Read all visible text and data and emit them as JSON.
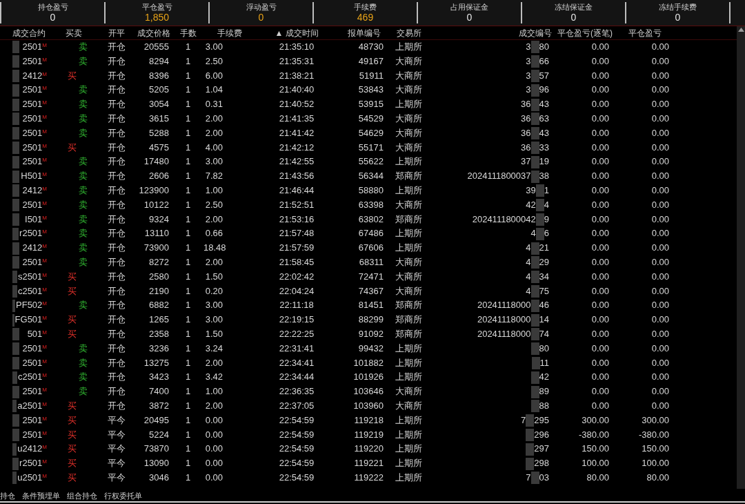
{
  "summary": [
    {
      "label": "持仓盈亏",
      "value": "0",
      "color": "#e6e6e6"
    },
    {
      "label": "平仓盈亏",
      "value": "1,850",
      "color": "#e8a317"
    },
    {
      "label": "浮动盈亏",
      "value": "0",
      "color": "#e8a317"
    },
    {
      "label": "手续费",
      "value": "469",
      "color": "#e8a317"
    },
    {
      "label": "占用保证金",
      "value": "0",
      "color": "#e6e6e6"
    },
    {
      "label": "冻结保证金",
      "value": "0",
      "color": "#e6e6e6"
    },
    {
      "label": "冻结手续费",
      "value": "0",
      "color": "#e6e6e6"
    }
  ],
  "table": {
    "columns": [
      "成交合约",
      "买卖",
      "开平",
      "成交价格",
      "手数",
      "手续费",
      "▲ 成交时间",
      "报单编号",
      "交易所",
      "成交编号",
      "平仓盈亏(逐笔)",
      "平仓盈亏"
    ],
    "rows": [
      {
        "contract": "2501$^{M}$",
        "kind": "sell",
        "side": "卖",
        "offset": "开仓",
        "price": "20555",
        "qty": "1",
        "fee": "3.00",
        "time": "21:35:10",
        "order_no": "48730",
        "exchange": "上期所",
        "trade_id_start": "3",
        "trade_id_end": "80",
        "pnl_trade": "0.00",
        "pnl": "0.00"
      },
      {
        "contract": "2501$^{M}$",
        "kind": "sell",
        "side": "卖",
        "offset": "开仓",
        "price": "8294",
        "qty": "1",
        "fee": "2.50",
        "time": "21:35:31",
        "order_no": "49167",
        "exchange": "大商所",
        "trade_id_start": "3",
        "trade_id_end": "66",
        "pnl_trade": "0.00",
        "pnl": "0.00"
      },
      {
        "contract": "2412$^{M}$",
        "kind": "buy",
        "side": "买",
        "offset": "开仓",
        "price": "8396",
        "qty": "1",
        "fee": "6.00",
        "time": "21:38:21",
        "order_no": "51911",
        "exchange": "大商所",
        "trade_id_start": "3",
        "trade_id_end": "57",
        "pnl_trade": "0.00",
        "pnl": "0.00"
      },
      {
        "contract": "2501$^{M}$",
        "kind": "sell",
        "side": "卖",
        "offset": "开仓",
        "price": "5205",
        "qty": "1",
        "fee": "1.04",
        "time": "21:40:40",
        "order_no": "53843",
        "exchange": "大商所",
        "trade_id_start": "3",
        "trade_id_end": "96",
        "pnl_trade": "0.00",
        "pnl": "0.00"
      },
      {
        "contract": "2501$^{M}$",
        "kind": "sell",
        "side": "卖",
        "offset": "开仓",
        "price": "3054",
        "qty": "1",
        "fee": "0.31",
        "time": "21:40:52",
        "order_no": "53915",
        "exchange": "上期所",
        "trade_id_start": "36",
        "trade_id_end": "43",
        "pnl_trade": "0.00",
        "pnl": "0.00"
      },
      {
        "contract": "2501$^{M}$",
        "kind": "sell",
        "side": "卖",
        "offset": "开仓",
        "price": "3615",
        "qty": "1",
        "fee": "2.00",
        "time": "21:41:35",
        "order_no": "54529",
        "exchange": "大商所",
        "trade_id_start": "36",
        "trade_id_end": "63",
        "pnl_trade": "0.00",
        "pnl": "0.00"
      },
      {
        "contract": "2501$^{M}$",
        "kind": "sell",
        "side": "卖",
        "offset": "开仓",
        "price": "5288",
        "qty": "1",
        "fee": "2.00",
        "time": "21:41:42",
        "order_no": "54629",
        "exchange": "大商所",
        "trade_id_start": "36",
        "trade_id_end": "43",
        "pnl_trade": "0.00",
        "pnl": "0.00"
      },
      {
        "contract": "2501$^{M}$",
        "kind": "buy",
        "side": "买",
        "offset": "开仓",
        "price": "4575",
        "qty": "1",
        "fee": "4.00",
        "time": "21:42:12",
        "order_no": "55171",
        "exchange": "大商所",
        "trade_id_start": "36",
        "trade_id_end": "33",
        "pnl_trade": "0.00",
        "pnl": "0.00"
      },
      {
        "contract": "2501$^{M}$",
        "kind": "sell",
        "side": "卖",
        "offset": "开仓",
        "price": "17480",
        "qty": "1",
        "fee": "3.00",
        "time": "21:42:55",
        "order_no": "55622",
        "exchange": "上期所",
        "trade_id_start": "37",
        "trade_id_end": "19",
        "pnl_trade": "0.00",
        "pnl": "0.00"
      },
      {
        "contract": "H501$^{M}$",
        "kind": "sell",
        "side": "卖",
        "offset": "开仓",
        "price": "2606",
        "qty": "1",
        "fee": "7.82",
        "time": "21:43:56",
        "order_no": "56344",
        "exchange": "郑商所",
        "trade_id_start": "2024111800037",
        "trade_id_end": "38",
        "pnl_trade": "0.00",
        "pnl": "0.00"
      },
      {
        "contract": "2412$^{M}$",
        "kind": "sell",
        "side": "卖",
        "offset": "开仓",
        "price": "123900",
        "qty": "1",
        "fee": "1.00",
        "time": "21:46:44",
        "order_no": "58880",
        "exchange": "上期所",
        "trade_id_start": "39",
        "trade_id_end": "1",
        "pnl_trade": "0.00",
        "pnl": "0.00"
      },
      {
        "contract": "2501$^{M}$",
        "kind": "sell",
        "side": "卖",
        "offset": "开仓",
        "price": "10122",
        "qty": "1",
        "fee": "2.50",
        "time": "21:52:51",
        "order_no": "63398",
        "exchange": "大商所",
        "trade_id_start": "42",
        "trade_id_end": "4",
        "pnl_trade": "0.00",
        "pnl": "0.00"
      },
      {
        "contract": "I501$^{M}$",
        "kind": "sell",
        "side": "卖",
        "offset": "开仓",
        "price": "9324",
        "qty": "1",
        "fee": "2.00",
        "time": "21:53:16",
        "order_no": "63802",
        "exchange": "郑商所",
        "trade_id_start": "2024111800042",
        "trade_id_end": "9",
        "pnl_trade": "0.00",
        "pnl": "0.00"
      },
      {
        "contract": "r2501$^{M}$",
        "kind": "sell",
        "side": "卖",
        "offset": "开仓",
        "price": "13110",
        "qty": "1",
        "fee": "0.66",
        "time": "21:57:48",
        "order_no": "67486",
        "exchange": "上期所",
        "trade_id_start": "4",
        "trade_id_end": "6",
        "pnl_trade": "0.00",
        "pnl": "0.00"
      },
      {
        "contract": "2412$^{M}$",
        "kind": "sell",
        "side": "卖",
        "offset": "开仓",
        "price": "73900",
        "qty": "1",
        "fee": "18.48",
        "time": "21:57:59",
        "order_no": "67606",
        "exchange": "上期所",
        "trade_id_start": "4",
        "trade_id_end": "21",
        "pnl_trade": "0.00",
        "pnl": "0.00"
      },
      {
        "contract": "2501$^{M}$",
        "kind": "sell",
        "side": "卖",
        "offset": "开仓",
        "price": "8272",
        "qty": "1",
        "fee": "2.00",
        "time": "21:58:45",
        "order_no": "68311",
        "exchange": "大商所",
        "trade_id_start": "4",
        "trade_id_end": "29",
        "pnl_trade": "0.00",
        "pnl": "0.00"
      },
      {
        "contract": "s2501$^{M}$",
        "kind": "buy",
        "side": "买",
        "offset": "开仓",
        "price": "2580",
        "qty": "1",
        "fee": "1.50",
        "time": "22:02:42",
        "order_no": "72471",
        "exchange": "大商所",
        "trade_id_start": "4",
        "trade_id_end": "34",
        "pnl_trade": "0.00",
        "pnl": "0.00"
      },
      {
        "contract": "c2501$^{M}$",
        "kind": "buy",
        "side": "买",
        "offset": "开仓",
        "price": "2190",
        "qty": "1",
        "fee": "0.20",
        "time": "22:04:24",
        "order_no": "74367",
        "exchange": "大商所",
        "trade_id_start": "4",
        "trade_id_end": "75",
        "pnl_trade": "0.00",
        "pnl": "0.00"
      },
      {
        "contract": "PF502$^{M}$",
        "kind": "sell",
        "side": "卖",
        "offset": "开仓",
        "price": "6882",
        "qty": "1",
        "fee": "3.00",
        "time": "22:11:18",
        "order_no": "81451",
        "exchange": "郑商所",
        "trade_id_start": "20241118000",
        "trade_id_end": "46",
        "pnl_trade": "0.00",
        "pnl": "0.00"
      },
      {
        "contract": "FG501$^{M}$",
        "kind": "buy",
        "side": "买",
        "offset": "开仓",
        "price": "1265",
        "qty": "1",
        "fee": "3.00",
        "time": "22:19:15",
        "order_no": "88299",
        "exchange": "郑商所",
        "trade_id_start": "20241118000",
        "trade_id_end": "14",
        "pnl_trade": "0.00",
        "pnl": "0.00"
      },
      {
        "contract": "501$^{M}$",
        "kind": "buy",
        "side": "买",
        "offset": "开仓",
        "price": "2358",
        "qty": "1",
        "fee": "1.50",
        "time": "22:22:25",
        "order_no": "91092",
        "exchange": "郑商所",
        "trade_id_start": "20241118000",
        "trade_id_end": "74",
        "pnl_trade": "0.00",
        "pnl": "0.00"
      },
      {
        "contract": "2501$^{M}$",
        "kind": "sell",
        "side": "卖",
        "offset": "开仓",
        "price": "3236",
        "qty": "1",
        "fee": "3.24",
        "time": "22:31:41",
        "order_no": "99432",
        "exchange": "上期所",
        "trade_id_end": "80",
        "pnl_trade": "0.00",
        "pnl": "0.00"
      },
      {
        "contract": "2501$^{M}$",
        "kind": "sell",
        "side": "卖",
        "offset": "开仓",
        "price": "13275",
        "qty": "1",
        "fee": "2.00",
        "time": "22:34:41",
        "order_no": "101882",
        "exchange": "上期所",
        "trade_id_end": "11",
        "pnl_trade": "0.00",
        "pnl": "0.00"
      },
      {
        "contract": "c2501$^{M}$",
        "kind": "sell",
        "side": "卖",
        "offset": "开仓",
        "price": "3423",
        "qty": "1",
        "fee": "3.42",
        "time": "22:34:44",
        "order_no": "101926",
        "exchange": "上期所",
        "trade_id_end": "42",
        "pnl_trade": "0.00",
        "pnl": "0.00"
      },
      {
        "contract": "2501$^{M}$",
        "kind": "sell",
        "side": "卖",
        "offset": "开仓",
        "price": "7400",
        "qty": "1",
        "fee": "1.00",
        "time": "22:36:35",
        "order_no": "103646",
        "exchange": "大商所",
        "trade_id_end": "89",
        "pnl_trade": "0.00",
        "pnl": "0.00"
      },
      {
        "contract": "a2501$^{M}$",
        "kind": "buy",
        "side": "买",
        "offset": "开仓",
        "price": "3872",
        "qty": "1",
        "fee": "2.00",
        "time": "22:37:05",
        "order_no": "103960",
        "exchange": "大商所",
        "trade_id_end": "88",
        "pnl_trade": "0.00",
        "pnl": "0.00"
      },
      {
        "contract": "2501$^{M}$",
        "kind": "buy",
        "side": "买",
        "offset": "平今",
        "price": "20495",
        "qty": "1",
        "fee": "0.00",
        "time": "22:54:59",
        "order_no": "119218",
        "exchange": "上期所",
        "trade_id_start": "7",
        "trade_id_end": "295",
        "pnl_trade": "300.00",
        "pnl": "300.00"
      },
      {
        "contract": "2501$^{M}$",
        "kind": "buy",
        "side": "买",
        "offset": "平今",
        "price": "5224",
        "qty": "1",
        "fee": "0.00",
        "time": "22:54:59",
        "order_no": "119219",
        "exchange": "上期所",
        "trade_id_end": "296",
        "pnl_trade": "-380.00",
        "pnl": "-380.00"
      },
      {
        "contract": "u2412$^{M}$",
        "kind": "buy",
        "side": "买",
        "offset": "平今",
        "price": "73870",
        "qty": "1",
        "fee": "0.00",
        "time": "22:54:59",
        "order_no": "119220",
        "exchange": "上期所",
        "trade_id_end": "297",
        "pnl_trade": "150.00",
        "pnl": "150.00"
      },
      {
        "contract": "r2501$^{M}$",
        "kind": "buy",
        "side": "买",
        "offset": "平今",
        "price": "13090",
        "qty": "1",
        "fee": "0.00",
        "time": "22:54:59",
        "order_no": "119221",
        "exchange": "上期所",
        "trade_id_end": "298",
        "pnl_trade": "100.00",
        "pnl": "100.00"
      },
      {
        "contract": "u2501$^{M}$",
        "kind": "buy",
        "side": "买",
        "offset": "平今",
        "price": "3046",
        "qty": "1",
        "fee": "0.00",
        "time": "22:54:59",
        "order_no": "119222",
        "exchange": "上期所",
        "trade_id_start": "7",
        "trade_id_end": "03",
        "pnl_trade": "80.00",
        "pnl": "80.00"
      }
    ]
  },
  "bottom_tabs": [
    "持仓",
    "条件预埋单",
    "组合持仓",
    "行权委托单"
  ]
}
